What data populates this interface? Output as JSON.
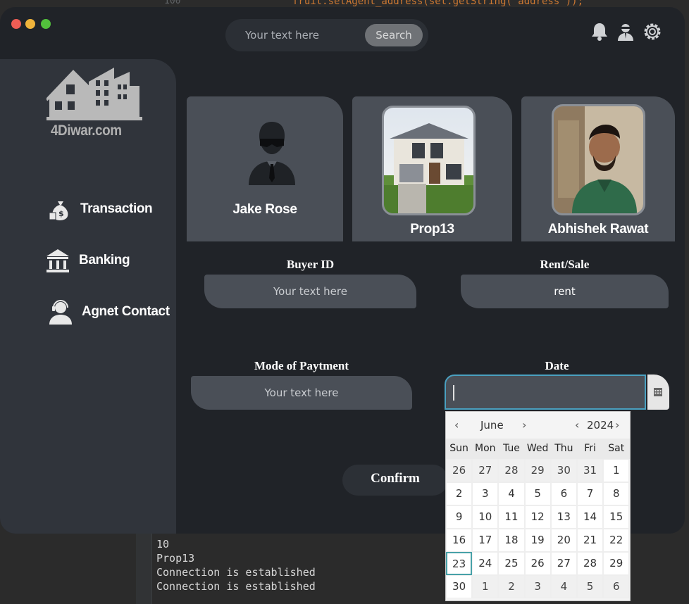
{
  "ide": {
    "line_number": "100",
    "code_line": "fruit.setAgent_address(set.getString(\"address\"));",
    "console_lines": [
      "10",
      "Prop13",
      "Connection is established",
      "Connection is established"
    ]
  },
  "header": {
    "search_placeholder": "Your text here",
    "search_button": "Search",
    "icons": [
      "bell-icon",
      "agent-icon",
      "settings-icon"
    ]
  },
  "sidebar": {
    "brand": "4Diwar.com",
    "items": [
      {
        "label": "Transaction",
        "icon": "money-bag-icon"
      },
      {
        "label": "Banking",
        "icon": "bank-icon"
      },
      {
        "label": "Agnet Contact",
        "icon": "support-agent-icon"
      }
    ]
  },
  "cards": [
    {
      "name": "Jake Rose",
      "image": "avatar-placeholder"
    },
    {
      "name": "Prop13",
      "image": "house-photo"
    },
    {
      "name": "Abhishek Rawat",
      "image": "agent-photo"
    }
  ],
  "form": {
    "buyer_id": {
      "label": "Buyer ID",
      "placeholder": "Your text here"
    },
    "rent_sale": {
      "label": "Rent/Sale",
      "value": "rent"
    },
    "mode_of_payment": {
      "label": "Mode of Paytment",
      "placeholder": "Your text here"
    },
    "date": {
      "label": "Date",
      "value": ""
    },
    "confirm_label": "Confirm"
  },
  "calendar": {
    "month": "June",
    "year": "2024",
    "weekdays": [
      "Sun",
      "Mon",
      "Tue",
      "Wed",
      "Thu",
      "Fri",
      "Sat"
    ],
    "weeks": [
      [
        "26",
        "27",
        "28",
        "29",
        "30",
        "31",
        "1"
      ],
      [
        "2",
        "3",
        "4",
        "5",
        "6",
        "7",
        "8"
      ],
      [
        "9",
        "10",
        "11",
        "12",
        "13",
        "14",
        "15"
      ],
      [
        "16",
        "17",
        "18",
        "19",
        "20",
        "21",
        "22"
      ],
      [
        "23",
        "24",
        "25",
        "26",
        "27",
        "28",
        "29"
      ],
      [
        "30",
        "1",
        "2",
        "3",
        "4",
        "5",
        "6"
      ]
    ],
    "today": "23",
    "colors": {
      "today_border": "#47a1a8",
      "accent": "#4aa0c0"
    }
  }
}
